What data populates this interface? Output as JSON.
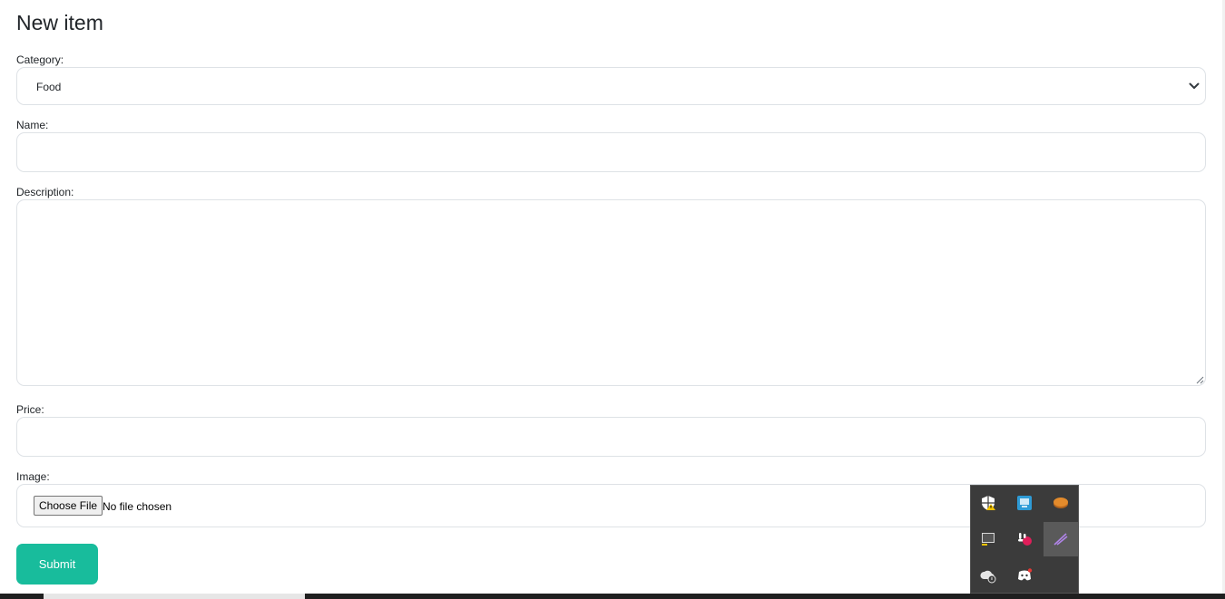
{
  "page": {
    "title": "New item"
  },
  "form": {
    "category_label": "Category:",
    "category_value": "Food",
    "name_label": "Name:",
    "name_value": "",
    "description_label": "Description:",
    "description_value": "",
    "price_label": "Price:",
    "price_value": "",
    "image_label": "Image:",
    "file_button_label": "Choose File",
    "file_status": "No file chosen",
    "submit_label": "Submit"
  },
  "colors": {
    "submit_bg": "#18bc9c",
    "field_border": "#dee2e6",
    "tray_bg": "#3b3b3b"
  },
  "tray_icons": [
    {
      "name": "windows-security-warning-icon"
    },
    {
      "name": "network-monitor-icon"
    },
    {
      "name": "pie-app-icon"
    },
    {
      "name": "display-icon"
    },
    {
      "name": "slack-icon"
    },
    {
      "name": "feather-app-icon"
    },
    {
      "name": "cloud-sync-icon"
    },
    {
      "name": "discord-icon"
    }
  ]
}
